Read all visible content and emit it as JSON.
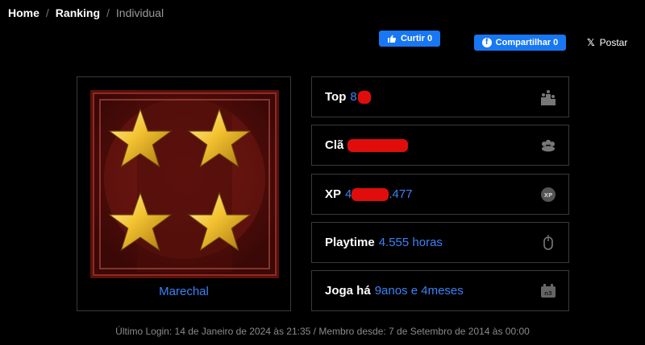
{
  "breadcrumb": {
    "home": "Home",
    "sep1": "/",
    "ranking": "Ranking",
    "sep2": "/",
    "current": "Individual"
  },
  "social": {
    "like_label": "Curtir 0",
    "share_label": "Compartilhar 0",
    "post_label": "Postar",
    "brand_color": "#1877f2"
  },
  "rank": {
    "name": "Marechal",
    "insignia": "four-gold-stars"
  },
  "stats": {
    "top": {
      "label": "Top",
      "value_prefix": "8"
    },
    "clan": {
      "label": "Clã"
    },
    "xp": {
      "label": "XP",
      "value_prefix": "4",
      "value_suffix": ".477"
    },
    "playtime": {
      "label": "Playtime",
      "value": "4.555 horas"
    },
    "joga": {
      "label": "Joga há",
      "value": "9anos e 4meses"
    }
  },
  "footer": {
    "text": "Último Login: 14 de Janeiro de 2024 às 21:35 / Membro desde: 7 de Setembro de 2014 às 00:00"
  },
  "colors": {
    "accent": "#3b82f6",
    "redaction": "#e10d0d",
    "border": "#3a3a3a"
  }
}
